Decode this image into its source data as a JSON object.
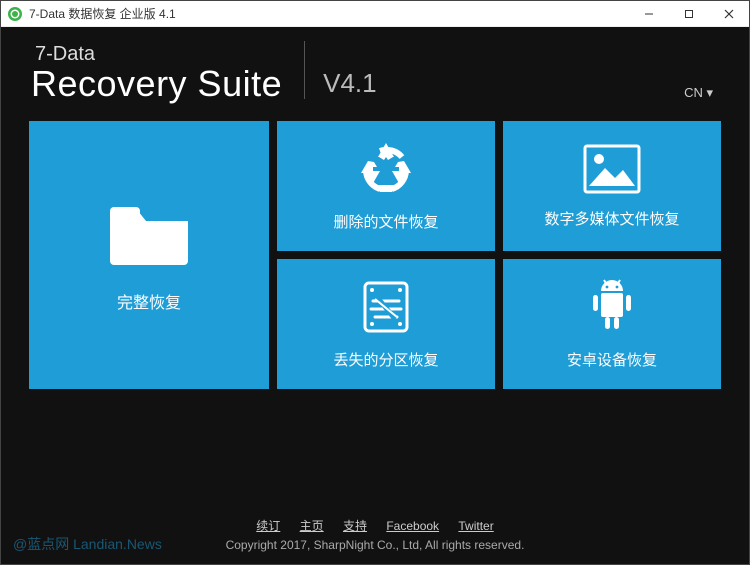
{
  "window": {
    "title": "7-Data 数据恢复 企业版 4.1"
  },
  "header": {
    "brand_small": "7-Data",
    "brand_big": "Recovery Suite",
    "version": "V4.1",
    "language_label": "CN ▾"
  },
  "tiles": {
    "full_recovery": "完整恢复",
    "deleted_recovery": "删除的文件恢复",
    "media_recovery": "数字多媒体文件恢复",
    "partition_recovery": "丢失的分区恢复",
    "android_recovery": "安卓设备恢复"
  },
  "footer": {
    "links": {
      "renew": "续订",
      "home": "主页",
      "support": "支持",
      "facebook": "Facebook",
      "twitter": "Twitter"
    },
    "copyright": "Copyright 2017, SharpNight Co., Ltd, All rights reserved."
  },
  "watermark": "@蓝点网 Landian.News"
}
